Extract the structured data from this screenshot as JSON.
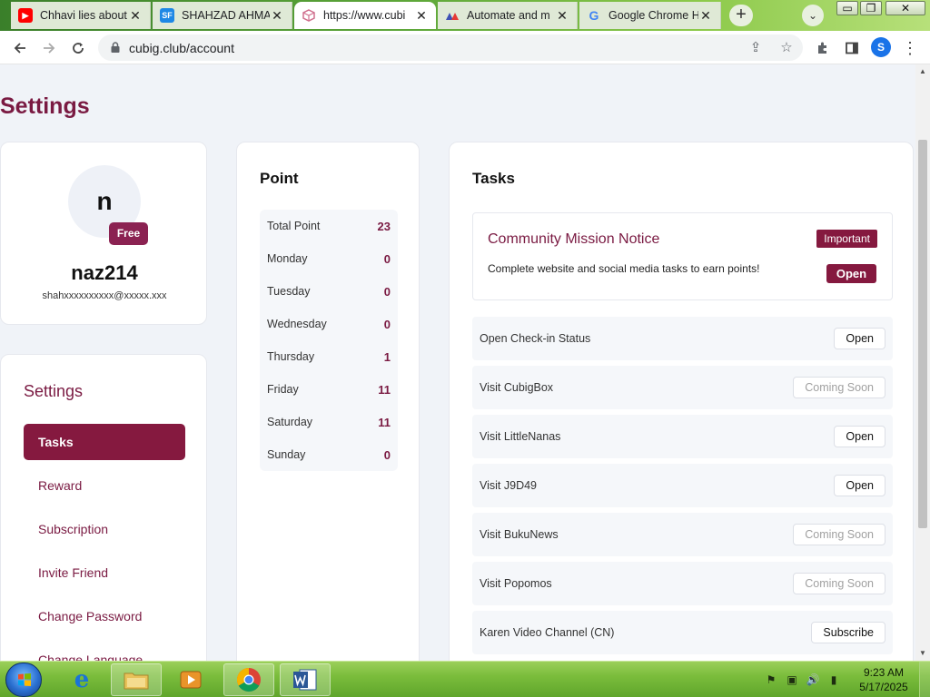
{
  "browser": {
    "tabs": [
      {
        "title": "Chhavi lies about",
        "icon": "youtube-icon"
      },
      {
        "title": "SHAHZAD AHMA",
        "icon": "sf-icon"
      },
      {
        "title": "https://www.cubi",
        "icon": "cubig-icon",
        "active": true
      },
      {
        "title": "Automate and m",
        "icon": "automate-icon"
      },
      {
        "title": "Google Chrome H",
        "icon": "google-icon"
      }
    ],
    "url": "cubig.club/account",
    "profile_initial": "S"
  },
  "page": {
    "title": "Settings"
  },
  "profile": {
    "initial": "n",
    "plan": "Free",
    "username": "naz214",
    "email": "shahxxxxxxxxxx@xxxxx.xxx"
  },
  "settings_menu": {
    "heading": "Settings",
    "items": [
      "Tasks",
      "Reward",
      "Subscription",
      "Invite Friend",
      "Change Password",
      "Change Language"
    ]
  },
  "points": {
    "title": "Point",
    "rows": [
      {
        "label": "Total Point",
        "value": "23"
      },
      {
        "label": "Monday",
        "value": "0"
      },
      {
        "label": "Tuesday",
        "value": "0"
      },
      {
        "label": "Wednesday",
        "value": "0"
      },
      {
        "label": "Thursday",
        "value": "1"
      },
      {
        "label": "Friday",
        "value": "11"
      },
      {
        "label": "Saturday",
        "value": "11"
      },
      {
        "label": "Sunday",
        "value": "0"
      }
    ]
  },
  "tasks": {
    "title": "Tasks",
    "notice": {
      "title": "Community Mission Notice",
      "badge": "Important",
      "text": "Complete website and social media tasks to earn points!",
      "button": "Open"
    },
    "items": [
      {
        "name": "Open Check-in Status",
        "button": "Open"
      },
      {
        "name": "Visit CubigBox",
        "button": "Coming Soon",
        "disabled": true
      },
      {
        "name": "Visit LittleNanas",
        "button": "Open"
      },
      {
        "name": "Visit J9D49",
        "button": "Open"
      },
      {
        "name": "Visit BukuNews",
        "button": "Coming Soon",
        "disabled": true
      },
      {
        "name": "Visit Popomos",
        "button": "Coming Soon",
        "disabled": true
      },
      {
        "name": "Karen Video Channel (CN)",
        "button": "Subscribe"
      }
    ]
  },
  "taskbar": {
    "time": "9:23 AM",
    "date": "5/17/2025"
  },
  "colors": {
    "brand": "#85193f",
    "brand_text": "#7a1a42"
  }
}
